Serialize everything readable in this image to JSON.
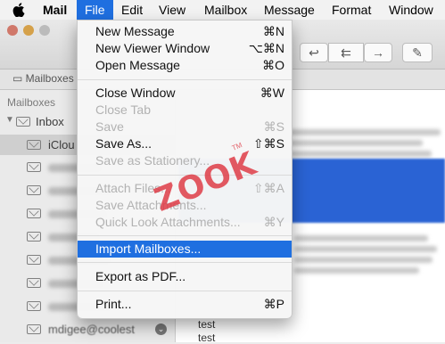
{
  "menubar": {
    "items": [
      {
        "label": "Mail"
      },
      {
        "label": "File"
      },
      {
        "label": "Edit"
      },
      {
        "label": "View"
      },
      {
        "label": "Mailbox"
      },
      {
        "label": "Message"
      },
      {
        "label": "Format"
      },
      {
        "label": "Window"
      }
    ],
    "active": "File"
  },
  "toolbar": {
    "icons": [
      "reply-icon",
      "reply-all-icon",
      "forward-icon",
      "compose-icon"
    ]
  },
  "favorites_bar": {
    "label": "Mailboxes"
  },
  "sidebar": {
    "header": "Mailboxes",
    "inbox": "Inbox",
    "icloud": "iClou",
    "last_account": "mdigee@coolest"
  },
  "message_list": {
    "preview_lines": [
      "test",
      "test"
    ]
  },
  "file_menu": {
    "items": [
      {
        "label": "New Message",
        "shortcut": "⌘N",
        "enabled": true
      },
      {
        "label": "New Viewer Window",
        "shortcut": "⌥⌘N",
        "enabled": true
      },
      {
        "label": "Open Message",
        "shortcut": "⌘O",
        "enabled": true
      },
      {
        "label": "Close Window",
        "shortcut": "⌘W",
        "enabled": true
      },
      {
        "label": "Close Tab",
        "shortcut": "",
        "enabled": false
      },
      {
        "label": "Save",
        "shortcut": "⌘S",
        "enabled": false
      },
      {
        "label": "Save As...",
        "shortcut": "⇧⌘S",
        "enabled": true
      },
      {
        "label": "Save as Stationery...",
        "shortcut": "",
        "enabled": false
      },
      {
        "label": "Attach Files...",
        "shortcut": "⇧⌘A",
        "enabled": false
      },
      {
        "label": "Save Attachments...",
        "shortcut": "",
        "enabled": false
      },
      {
        "label": "Quick Look Attachments...",
        "shortcut": "⌘Y",
        "enabled": false
      },
      {
        "label": "Import Mailboxes...",
        "shortcut": "",
        "enabled": true,
        "highlighted": true
      },
      {
        "label": "Export as PDF...",
        "shortcut": "",
        "enabled": true
      },
      {
        "label": "Print...",
        "shortcut": "⌘P",
        "enabled": true
      }
    ]
  },
  "watermark": {
    "text": "ZOOK",
    "tm": "TM"
  },
  "colors": {
    "selection": "#1f6fe0",
    "watermark": "#de3c46"
  }
}
